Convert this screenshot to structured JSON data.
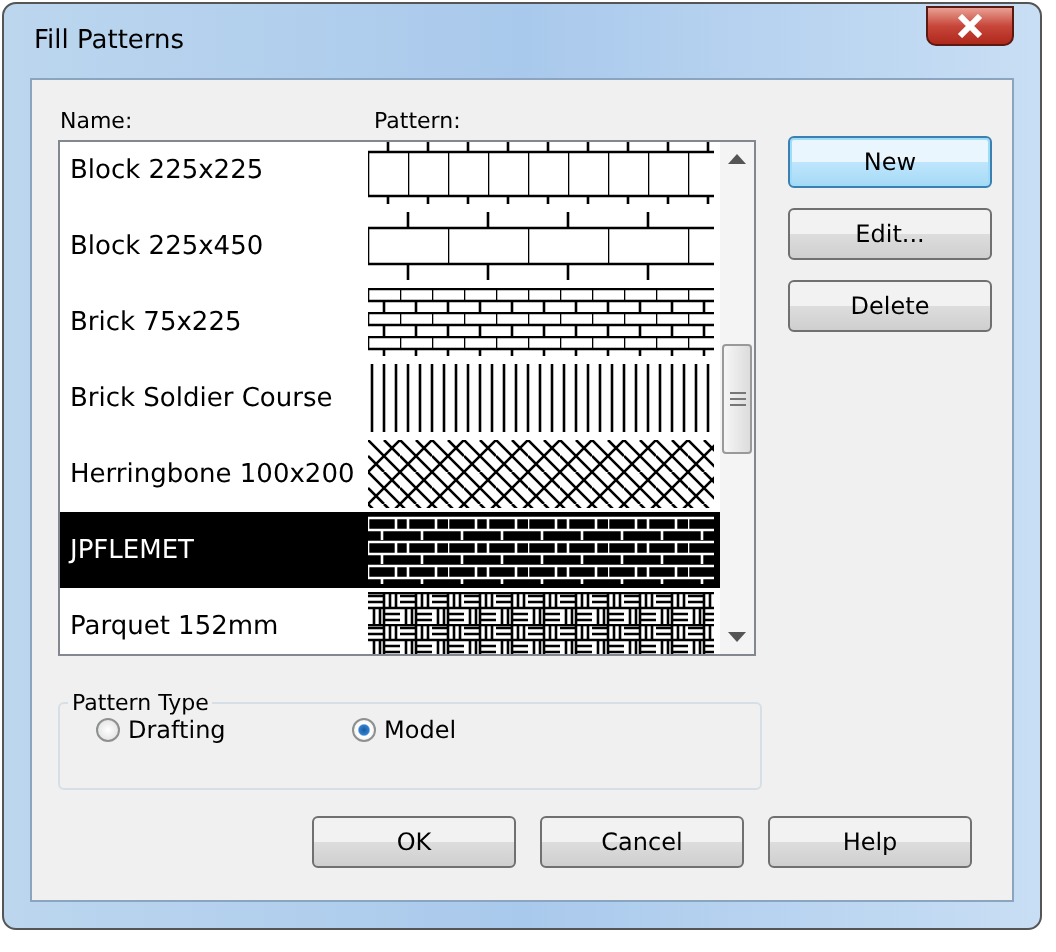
{
  "window": {
    "title": "Fill Patterns"
  },
  "columns": [
    "Name:",
    "Pattern:"
  ],
  "patterns": [
    {
      "name": "Block 225x225",
      "kind": "block-square",
      "selected": false
    },
    {
      "name": "Block 225x450",
      "kind": "block-wide",
      "selected": false
    },
    {
      "name": "Brick 75x225",
      "kind": "brick",
      "selected": false
    },
    {
      "name": "Brick Soldier Course",
      "kind": "soldier",
      "selected": false
    },
    {
      "name": "Herringbone 100x200",
      "kind": "herringbone",
      "selected": false
    },
    {
      "name": "JPFLEMET",
      "kind": "flemish",
      "selected": true
    },
    {
      "name": "Parquet 152mm",
      "kind": "parquet",
      "selected": false
    }
  ],
  "side_buttons": [
    {
      "label": "New",
      "default": true
    },
    {
      "label": "Edit...",
      "default": false
    },
    {
      "label": "Delete",
      "default": false
    }
  ],
  "pattern_type": {
    "title": "Pattern Type",
    "options": [
      {
        "label": "Drafting",
        "selected": false
      },
      {
        "label": "Model",
        "selected": true
      }
    ]
  },
  "buttons": [
    "OK",
    "Cancel",
    "Help"
  ]
}
